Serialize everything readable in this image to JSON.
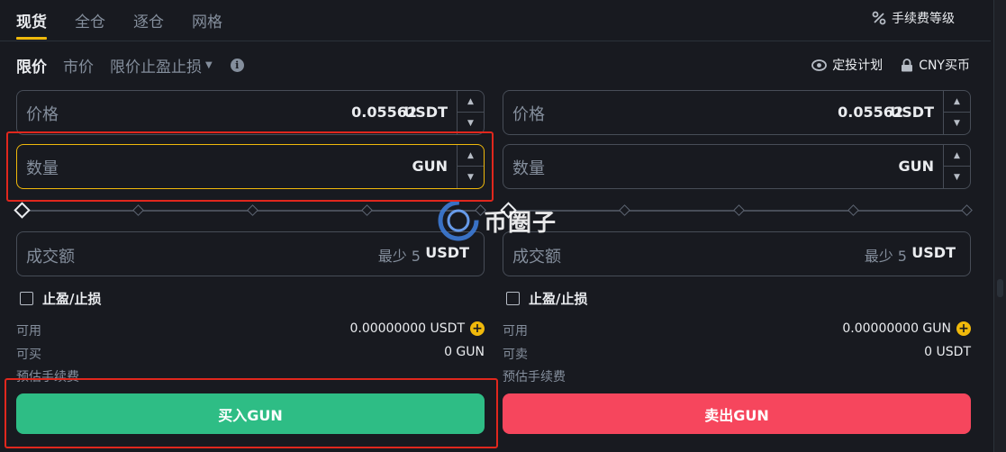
{
  "top_tabs": [
    "现货",
    "全仓",
    "逐仓",
    "网格"
  ],
  "fee_level_label": "手续费等级",
  "order_types": {
    "limit": "限价",
    "market": "市价",
    "stop_limit": "限价止盈止损"
  },
  "links": {
    "recurring": "定投计划",
    "cny_buy": "CNY买币"
  },
  "buy": {
    "price_label": "价格",
    "price_value": "0.05562",
    "price_unit": "USDT",
    "amount_label": "数量",
    "amount_unit": "GUN",
    "total_label": "成交额",
    "total_min": "最少 5",
    "total_unit": "USDT",
    "tp_sl_label": "止盈/止损",
    "avail_label": "可用",
    "avail_value": "0.00000000 USDT",
    "max_label": "可买",
    "max_value": "0 GUN",
    "fee_label": "预估手续费",
    "button": "买入GUN"
  },
  "sell": {
    "price_label": "价格",
    "price_value": "0.05562",
    "price_unit": "USDT",
    "amount_label": "数量",
    "amount_unit": "GUN",
    "total_label": "成交额",
    "total_min": "最少 5",
    "total_unit": "USDT",
    "tp_sl_label": "止盈/止损",
    "avail_label": "可用",
    "avail_value": "0.00000000 GUN",
    "max_label": "可卖",
    "max_value": "0 USDT",
    "fee_label": "预估手续费",
    "button": "卖出GUN"
  },
  "watermark_text": "币圈子",
  "slider_percent": 0,
  "colors": {
    "accent": "#f0b90b",
    "buy": "#2ebd85",
    "sell": "#f6465d",
    "annotation": "#e0271d"
  },
  "icons": [
    "percent-icon",
    "info-icon",
    "recurring-plan-icon",
    "lock-icon",
    "plus-icon",
    "checkbox-icon"
  ]
}
